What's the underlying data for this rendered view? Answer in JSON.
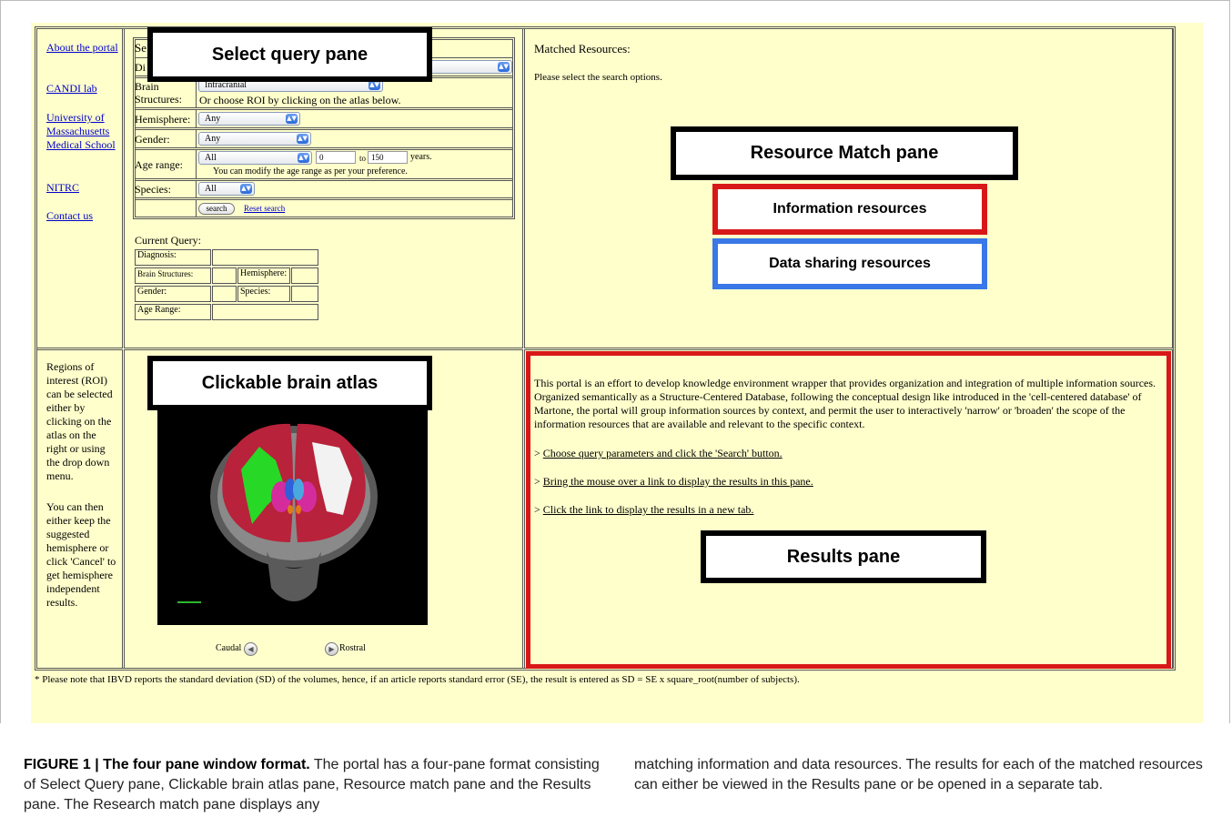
{
  "nav": {
    "about": "About the portal",
    "candi": "CANDI lab",
    "umass": "University of Massachusetts Medical School",
    "nitrc": "NITRC",
    "contact": "Contact us"
  },
  "query": {
    "title_fragment": "Se",
    "diagnosis_label": "Di",
    "brain_label": "Brain Structures:",
    "brain_value": "Intracranial",
    "brain_hint": "Or choose ROI by clicking on the atlas below.",
    "hemisphere_label": "Hemisphere:",
    "hemisphere_value": "Any",
    "gender_label": "Gender:",
    "gender_value": "Any",
    "age_label": "Age range:",
    "age_value": "All",
    "age_min": "0",
    "age_to": "to",
    "age_max": "150",
    "age_unit": "years.",
    "age_hint": "You can modify the age range as per your preference.",
    "species_label": "Species:",
    "species_value": "All",
    "search_button": "search",
    "reset_link": "Reset search"
  },
  "current_query": {
    "title": "Current Query:",
    "diagnosis": "Diagnosis:",
    "brain": "Brain Structures:",
    "hemisphere": "Hemisphere:",
    "gender": "Gender:",
    "species": "Species:",
    "age": "Age Range:"
  },
  "match": {
    "title": "Matched Resources:",
    "message": "Please select the search options."
  },
  "roi_help": {
    "para1": "Regions of interest (ROI) can be selected either by clicking on the atlas on the right or using the drop down menu.",
    "para2": "You can then either keep the suggested hemisphere or click 'Cancel' to get hemisphere independent results."
  },
  "atlas": {
    "caudal": "Caudal",
    "rostral": "Rostral"
  },
  "results": {
    "intro": "This portal is an effort to develop knowledge environment wrapper that provides organization and integration of multiple information sources. Organized semantically as a Structure-Centered Database, following the conceptual design like introduced in the 'cell-centered database' of Martone, the portal will group information sources by context, and permit the user to interactively 'narrow' or 'broaden' the scope of the information resources that are available and relevant to the specific context.",
    "step1": "Choose query parameters and click the 'Search' button.",
    "step2": "Bring the mouse over a link to display the results in this pane.",
    "step3": "Click the link to display the results in a new tab.",
    "bullet": ">"
  },
  "footnote": "* Please note that IBVD reports the standard deviation (SD) of the volumes, hence, if an article reports standard error (SE), the result is entered as SD = SE x square_root(number of subjects).",
  "callouts": {
    "select_query": "Select query pane",
    "resource_match": "Resource Match pane",
    "information": "Information resources",
    "data_sharing": "Data sharing resources",
    "atlas": "Clickable brain atlas",
    "results": "Results pane"
  },
  "caption": {
    "label": "FIGURE 1 | The four pane window format.",
    "left_text": "The portal has a four-pane format consisting of Select Query pane, Clickable brain atlas pane, Resource match pane and the Results pane. The Research match pane displays any",
    "right_text": "matching information and data resources. The results for each of the matched resources can either be viewed in the Results pane or be opened in a separate tab."
  },
  "colors": {
    "page_bg": "#ffffcc",
    "link": "#0000cc",
    "information_border": "#d81818",
    "data_sharing_border": "#3a78e8",
    "results_outline": "#d81818"
  }
}
